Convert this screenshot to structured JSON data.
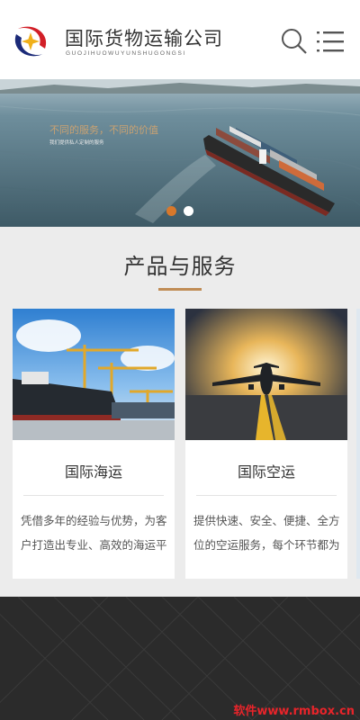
{
  "header": {
    "company_name": "国际货物运输公司",
    "company_pinyin": "GUOJIHUOWUYUNSHUGONGSI",
    "search_icon": "search-icon",
    "menu_icon": "menu-icon"
  },
  "banner": {
    "slogan": "不同的服务，不同的价值",
    "slogan_sub": "我们提供私人定制的服务",
    "slides": 2,
    "active_slide": 1
  },
  "products": {
    "title": "产品与服务",
    "items": [
      {
        "title": "国际海运",
        "description": "凭借多年的经验与优势，为客户打造出专业、高效的海运平台"
      },
      {
        "title": "国际空运",
        "description": "提供快速、安全、便捷、全方位的空运服务，每个环节都为"
      }
    ]
  },
  "footer": {
    "watermark": "软件www.rmbox.cn"
  },
  "colors": {
    "accent": "#d8782b",
    "title_bar": "#c08c55",
    "logo_red": "#d21f27",
    "logo_navy": "#1b2a78",
    "logo_gold": "#f0b01a",
    "watermark": "#e8242a"
  }
}
